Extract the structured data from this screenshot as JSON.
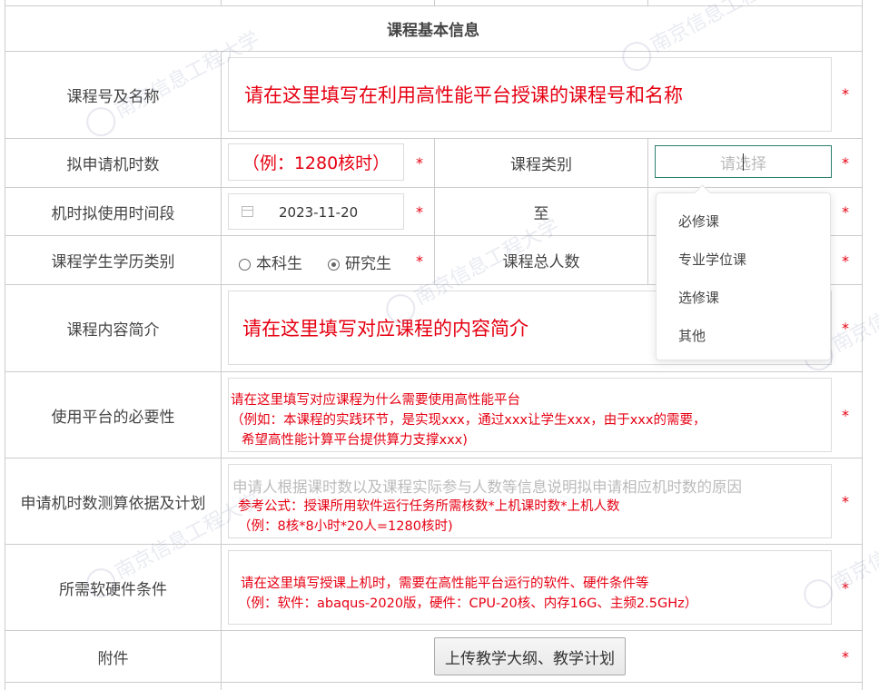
{
  "section_title": "课程基本信息",
  "rows": {
    "course": {
      "label": "课程号及名称",
      "hint": "请在这里填写在利用高性能平台授课的课程号和名称"
    },
    "hours": {
      "label": "拟申请机时数",
      "hint": "（例：1280核时）"
    },
    "category": {
      "label": "课程类别",
      "placeholder": "请选择"
    },
    "period": {
      "label": "机时拟使用时间段",
      "start_date": "2023-11-20",
      "to": "至"
    },
    "level": {
      "label": "课程学生学历类别",
      "options": [
        "本科生",
        "研究生"
      ],
      "selected": "研究生"
    },
    "students": {
      "label": "课程总人数"
    },
    "intro": {
      "label": "课程内容简介",
      "hint": "请在这里填写对应课程的内容简介"
    },
    "necessity": {
      "label": "使用平台的必要性",
      "lines": [
        "请在这里填写对应课程为什么需要使用高性能平台",
        "（例如：本课程的实践环节，是实现xxx，通过xxx让学生xxx，由于xxx的需要，",
        "希望高性能计算平台提供算力支撑xxx)"
      ]
    },
    "calc": {
      "label": "申请机时数测算依据及计划",
      "placeholder": "申请人根据课时数以及课程实际参与人数等信息说明拟申请相应机时数的原因",
      "lines": [
        "参考公式：授课所用软件运行任务所需核数*上机课时数*上机人数",
        "（例：8核*8小时*20人=1280核时)"
      ]
    },
    "hardware": {
      "label": "所需软硬件条件",
      "lines": [
        "请在这里填写授课上机时，需要在高性能平台运行的软件、硬件条件等",
        "（例：软件：abaqus-2020版，硬件：CPU-20核、内存16G、主频2.5GHz）"
      ]
    },
    "attachment": {
      "label": "附件",
      "button": "上传教学大纲、教学计划"
    }
  },
  "category_dropdown": [
    "必修课",
    "专业学位课",
    "选修课",
    "其他"
  ],
  "required_mark": "*",
  "watermark_text": "南京信息工程大学",
  "colors": {
    "hint_red": "#e60012",
    "border": "#cccccc",
    "label": "#444444"
  }
}
